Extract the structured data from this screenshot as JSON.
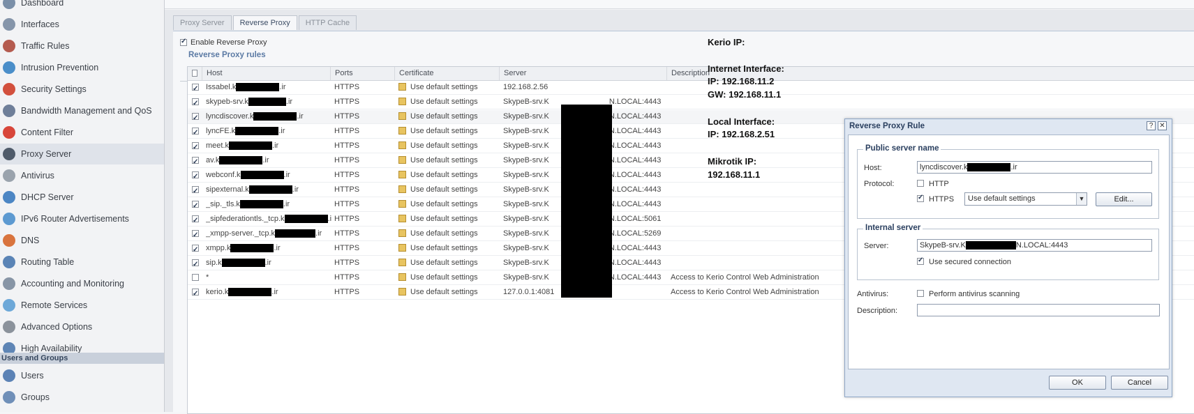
{
  "sidebar": {
    "items": [
      {
        "label": "Dashboard",
        "icon": "dashboard-icon",
        "color": "#7a8fa8"
      },
      {
        "label": "Interfaces",
        "icon": "interfaces-icon",
        "color": "#8595aa"
      },
      {
        "label": "Traffic Rules",
        "icon": "traffic-rules-icon",
        "color": "#b45b4f"
      },
      {
        "label": "Intrusion Prevention",
        "icon": "shield-icon",
        "color": "#4a8ec9"
      },
      {
        "label": "Security Settings",
        "icon": "security-icon",
        "color": "#d2503d"
      },
      {
        "label": "Bandwidth Management and QoS",
        "icon": "bandwidth-icon",
        "color": "#6f7f99"
      },
      {
        "label": "Content Filter",
        "icon": "filter-icon",
        "color": "#d8463a"
      },
      {
        "label": "Proxy Server",
        "icon": "proxy-icon",
        "color": "#4f5b6a"
      },
      {
        "label": "Antivirus",
        "icon": "antivirus-icon",
        "color": "#9aa3ad"
      },
      {
        "label": "DHCP Server",
        "icon": "dhcp-icon",
        "color": "#4c86c4"
      },
      {
        "label": "IPv6 Router Advertisements",
        "icon": "ipv6-icon",
        "color": "#5d9ad1"
      },
      {
        "label": "DNS",
        "icon": "dns-icon",
        "color": "#d9743e"
      },
      {
        "label": "Routing Table",
        "icon": "routing-icon",
        "color": "#5a84b6"
      },
      {
        "label": "Accounting and Monitoring",
        "icon": "accounting-icon",
        "color": "#8795a6"
      },
      {
        "label": "Remote Services",
        "icon": "cloud-icon",
        "color": "#6da8d8"
      },
      {
        "label": "Advanced Options",
        "icon": "gears-icon",
        "color": "#8b929b"
      },
      {
        "label": "High Availability",
        "icon": "servers-icon",
        "color": "#5e85b5"
      }
    ],
    "section_label": "Users and Groups",
    "users_items": [
      {
        "label": "Users",
        "icon": "user-icon",
        "color": "#5b82b5"
      },
      {
        "label": "Groups",
        "icon": "group-icon",
        "color": "#6f8fb8"
      }
    ]
  },
  "tabs": [
    "Proxy Server",
    "Reverse Proxy",
    "HTTP Cache"
  ],
  "enable_label": "Enable Reverse Proxy",
  "rules_title": "Reverse Proxy rules",
  "columns": [
    "Host",
    "Ports",
    "Certificate",
    "Server",
    "Description"
  ],
  "rows": [
    {
      "host_prefix": "Issabel.k",
      "host_suffix": ".ir",
      "ports": "HTTPS",
      "cert": "Use default settings",
      "server": "192.168.2.56",
      "desc": "",
      "checked": true
    },
    {
      "host_prefix": "skypeb-srv.k",
      "host_suffix": ".ir",
      "ports": "HTTPS",
      "cert": "Use default settings",
      "server": "SkypeB-srv.K",
      "server_suffix": "N.LOCAL:4443",
      "desc": "",
      "checked": true
    },
    {
      "host_prefix": "lyncdiscover.k",
      "host_suffix": ".ir",
      "ports": "HTTPS",
      "cert": "Use default settings",
      "server": "SkypeB-srv.K",
      "server_suffix": "N.LOCAL:4443",
      "desc": "",
      "checked": true
    },
    {
      "host_prefix": "lyncFE.k",
      "host_suffix": ".ir",
      "ports": "HTTPS",
      "cert": "Use default settings",
      "server": "SkypeB-srv.K",
      "server_suffix": "N.LOCAL:4443",
      "desc": "",
      "checked": true
    },
    {
      "host_prefix": "meet.k",
      "host_suffix": ".ir",
      "ports": "HTTPS",
      "cert": "Use default settings",
      "server": "SkypeB-srv.K",
      "server_suffix": "N.LOCAL:4443",
      "desc": "",
      "checked": true
    },
    {
      "host_prefix": "av.k",
      "host_suffix": ".ir",
      "ports": "HTTPS",
      "cert": "Use default settings",
      "server": "SkypeB-srv.K",
      "server_suffix": "N.LOCAL:4443",
      "desc": "",
      "checked": true
    },
    {
      "host_prefix": "webconf.k",
      "host_suffix": ".ir",
      "ports": "HTTPS",
      "cert": "Use default settings",
      "server": "SkypeB-srv.K",
      "server_suffix": "N.LOCAL:4443",
      "desc": "",
      "checked": true
    },
    {
      "host_prefix": "sipexternal.k",
      "host_suffix": ".ir",
      "ports": "HTTPS",
      "cert": "Use default settings",
      "server": "SkypeB-srv.K",
      "server_suffix": "N.LOCAL:4443",
      "desc": "",
      "checked": true
    },
    {
      "host_prefix": "_sip._tls.k",
      "host_suffix": ".ir",
      "ports": "HTTPS",
      "cert": "Use default settings",
      "server": "SkypeB-srv.K",
      "server_suffix": "N.LOCAL:4443",
      "desc": "",
      "checked": true
    },
    {
      "host_prefix": "_sipfederationtls._tcp.k",
      "host_suffix": ".ir",
      "ports": "HTTPS",
      "cert": "Use default settings",
      "server": "SkypeB-srv.K",
      "server_suffix": "N.LOCAL:5061",
      "desc": "",
      "checked": true
    },
    {
      "host_prefix": "_xmpp-server._tcp.k",
      "host_suffix": ".ir",
      "ports": "HTTPS",
      "cert": "Use default settings",
      "server": "SkypeB-srv.K",
      "server_suffix": "N.LOCAL:5269",
      "desc": "",
      "checked": true
    },
    {
      "host_prefix": "xmpp.k",
      "host_suffix": ".ir",
      "ports": "HTTPS",
      "cert": "Use default settings",
      "server": "SkypeB-srv.K",
      "server_suffix": "N.LOCAL:4443",
      "desc": "",
      "checked": true
    },
    {
      "host_prefix": "sip.k",
      "host_suffix": ".ir",
      "ports": "HTTPS",
      "cert": "Use default settings",
      "server": "SkypeB-srv.K",
      "server_suffix": "N.LOCAL:4443",
      "desc": "",
      "checked": true
    },
    {
      "host_prefix": "*",
      "host_suffix": "",
      "ports": "HTTPS",
      "cert": "Use default settings",
      "server": "SkypeB-srv.K",
      "server_suffix": "N.LOCAL:4443",
      "desc": "Access to Kerio Control Web Administration",
      "checked": false
    },
    {
      "host_prefix": "kerio.k",
      "host_suffix": ".ir",
      "ports": "HTTPS",
      "cert": "Use default settings",
      "server": "127.0.0.1:4081",
      "desc": "Access to Kerio Control Web Administration",
      "checked": true
    }
  ],
  "overlay": {
    "kerio_ip": "Kerio IP:",
    "internet_interface": "Internet Interface:",
    "internet_ip": "IP: 192.168.11.2",
    "gw": "GW: 192.168.11.1",
    "local_interface": "Local Interface:",
    "local_ip": "IP: 192.168.2.51",
    "mikrotik": "Mikrotik IP:",
    "mikrotik_ip": "192.168.11.1"
  },
  "dialog": {
    "title": "Reverse Proxy Rule",
    "help": "?",
    "close": "✕",
    "public_title": "Public server name",
    "host_label": "Host:",
    "host_prefix": "lyncdiscover.k",
    "host_suffix": ".ir",
    "protocol_label": "Protocol:",
    "http_label": "HTTP",
    "https_label": "HTTPS",
    "cert_select": "Use default settings",
    "edit_label": "Edit...",
    "internal_title": "Internal server",
    "server_label": "Server:",
    "server_prefix": "SkypeB-srv.K",
    "server_suffix": "N.LOCAL:4443",
    "secured_label": "Use secured connection",
    "antivirus_label": "Antivirus:",
    "scan_label": "Perform antivirus scanning",
    "description_label": "Description:",
    "ok_label": "OK",
    "cancel_label": "Cancel"
  }
}
